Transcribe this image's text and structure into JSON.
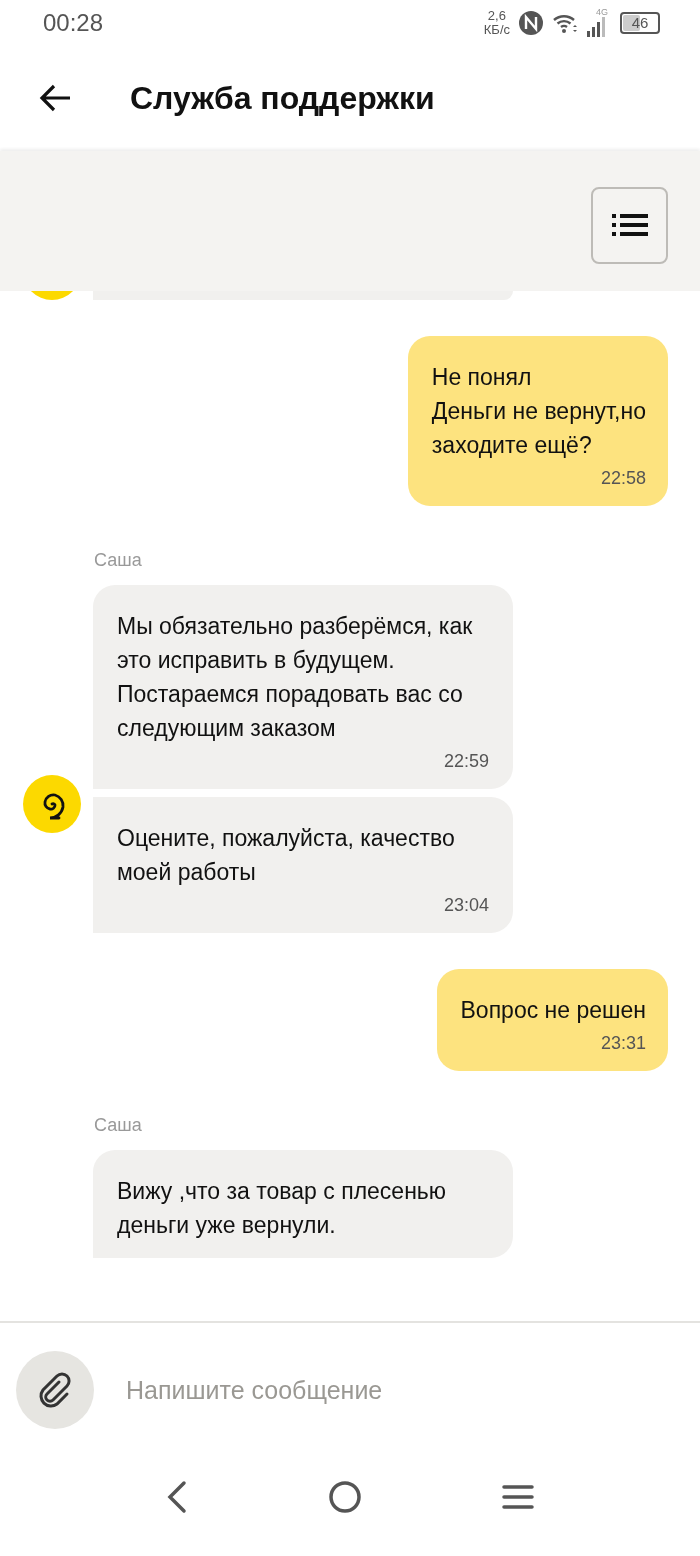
{
  "status_bar": {
    "time": "00:28",
    "speed_value": "2,6",
    "speed_unit": "КБ/с",
    "network": "4G",
    "battery": "46"
  },
  "header": {
    "title": "Служба поддержки"
  },
  "messages": [
    {
      "kind": "cut_off"
    },
    {
      "kind": "outgoing",
      "text": "Не понял\nДеньги не вернут,но\nзаходите ещё?",
      "time": "22:58"
    },
    {
      "kind": "sender",
      "name": "Саша"
    },
    {
      "kind": "incoming_group",
      "avatar": true,
      "bubbles": [
        {
          "text": "Мы обязательно разберёмся, как это исправить в будущем. Постараемся порадовать вас со следующим заказом",
          "time": "22:59"
        },
        {
          "text": "Оцените, пожалуйста, качество моей работы",
          "time": "23:04"
        }
      ]
    },
    {
      "kind": "outgoing",
      "text": "Вопрос не решен",
      "time": "23:31"
    },
    {
      "kind": "sender",
      "name": "Саша"
    },
    {
      "kind": "incoming_group",
      "bubbles": [
        {
          "text": "Вижу ,что за товар с плесенью деньги уже вернули."
        }
      ]
    }
  ],
  "composer": {
    "placeholder": "Напишите сообщение"
  }
}
